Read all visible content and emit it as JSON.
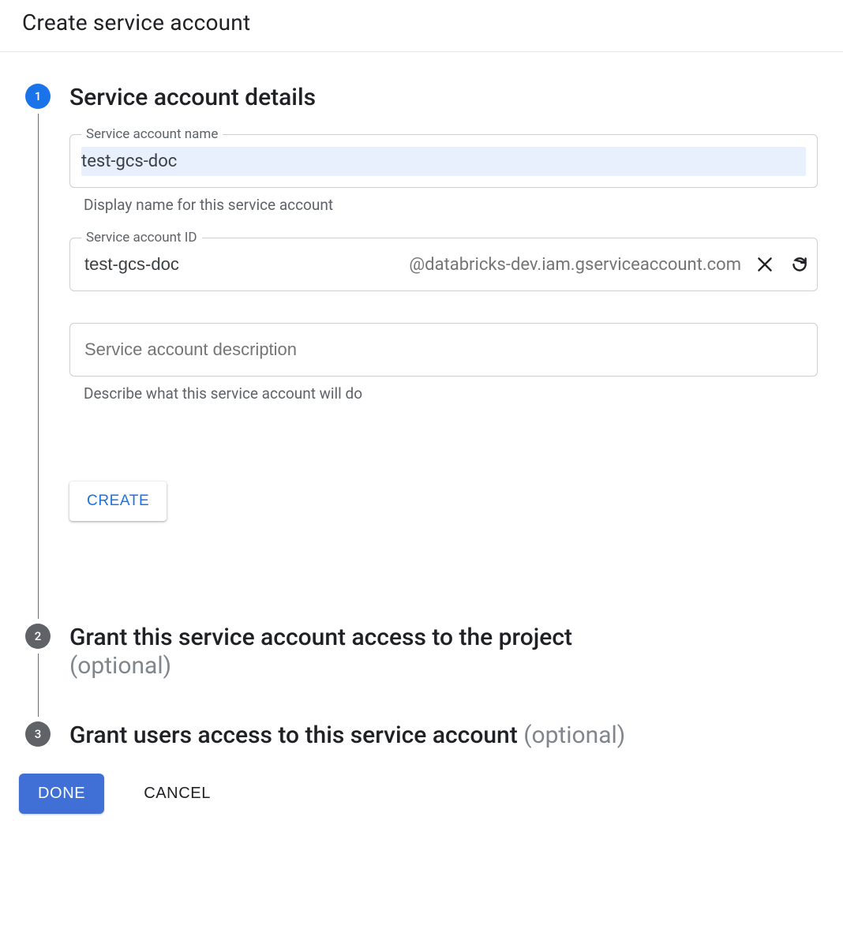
{
  "header": {
    "title": "Create service account"
  },
  "steps": {
    "s1": {
      "number": "1",
      "title": "Service account details",
      "name_field": {
        "label": "Service account name",
        "value": "test-gcs-doc",
        "helper": "Display name for this service account"
      },
      "id_field": {
        "label": "Service account ID",
        "value": "test-gcs-doc",
        "suffix": "@databricks-dev.iam.gserviceaccount.com"
      },
      "desc_field": {
        "placeholder": "Service account description",
        "helper": "Describe what this service account will do"
      },
      "create_label": "CREATE"
    },
    "s2": {
      "number": "2",
      "title": "Grant this service account access to the project",
      "optional": "(optional)"
    },
    "s3": {
      "number": "3",
      "title": "Grant users access to this service account",
      "optional": "(optional)"
    }
  },
  "actions": {
    "done": "DONE",
    "cancel": "CANCEL"
  }
}
